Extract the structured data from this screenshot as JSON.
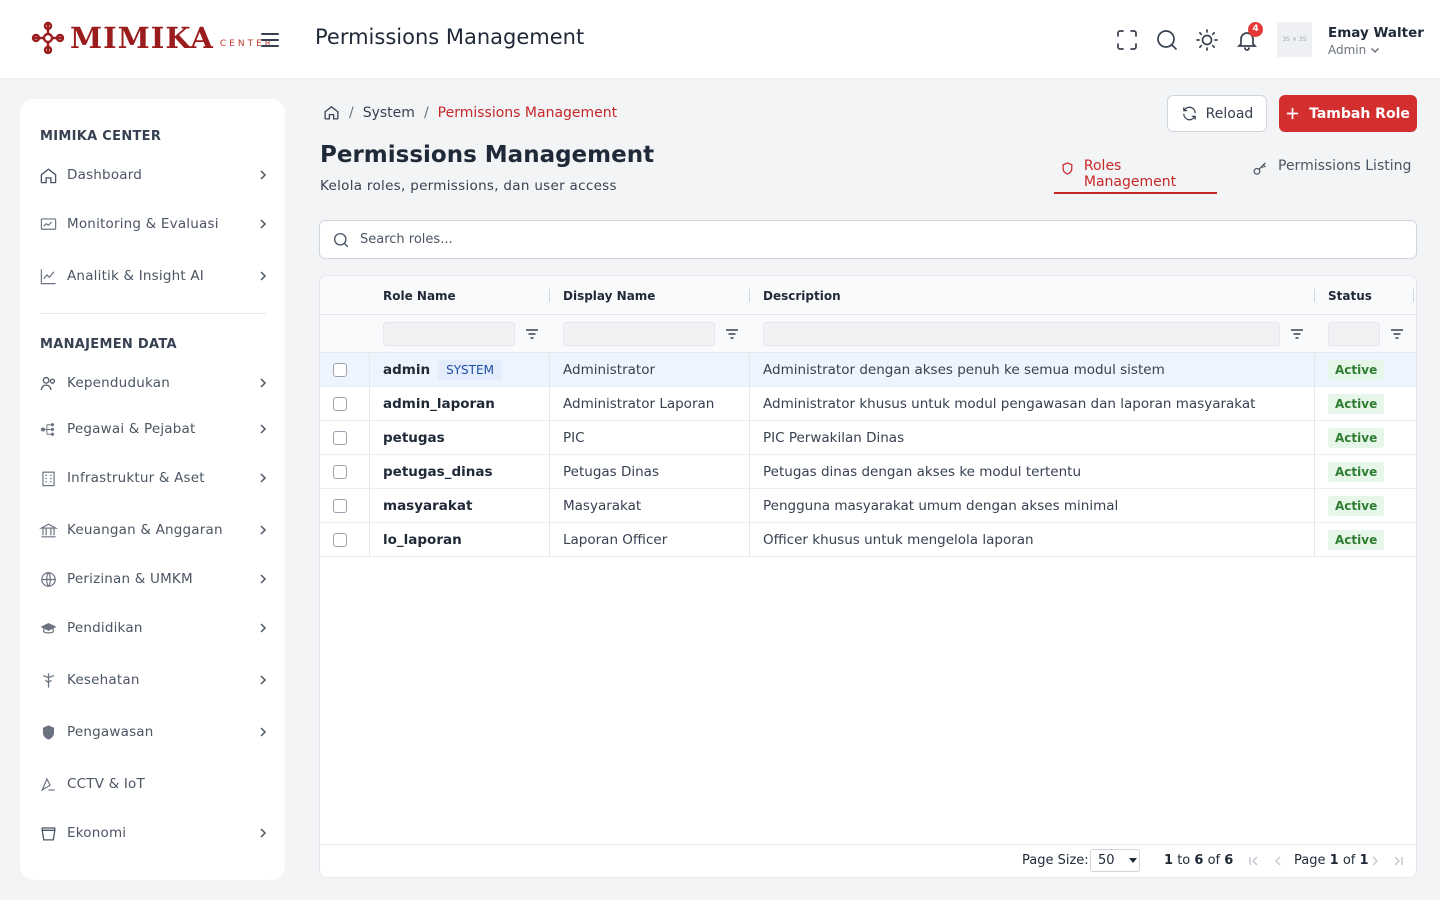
{
  "brand": {
    "name": "MIMIKA",
    "sub": "CENTER"
  },
  "header": {
    "title": "Permissions Management",
    "notification_count": "4",
    "avatar_placeholder": "35 × 35",
    "user_name": "Emay Walter",
    "user_role": "Admin"
  },
  "sidebar": {
    "section1": "MIMIKA CENTER",
    "section2": "MANAJEMEN DATA",
    "items1": [
      {
        "label": "Dashboard",
        "icon": "home-icon"
      },
      {
        "label": "Monitoring & Evaluasi",
        "icon": "monitor-icon"
      },
      {
        "label": "Analitik & Insight AI",
        "icon": "chart-line-icon"
      }
    ],
    "items2": [
      {
        "label": "Kependudukan",
        "icon": "users-icon"
      },
      {
        "label": "Pegawai & Pejabat",
        "icon": "org-chart-icon"
      },
      {
        "label": "Infrastruktur & Aset",
        "icon": "building-icon"
      },
      {
        "label": "Keuangan & Anggaran",
        "icon": "bank-icon"
      },
      {
        "label": "Perizinan & UMKM",
        "icon": "globe-icon"
      },
      {
        "label": "Pendidikan",
        "icon": "graduation-cap-icon"
      },
      {
        "label": "Kesehatan",
        "icon": "caduceus-icon"
      },
      {
        "label": "Pengawasan",
        "icon": "shield-icon"
      },
      {
        "label": "CCTV & IoT",
        "icon": "cctv-icon"
      },
      {
        "label": "Ekonomi",
        "icon": "basket-icon"
      }
    ]
  },
  "breadcrumb": {
    "level1": "System",
    "sep": "/",
    "current": "Permissions Management"
  },
  "actions": {
    "reload": "Reload",
    "add": "Tambah Role"
  },
  "page": {
    "title": "Permissions Management",
    "subtitle": "Kelola roles, permissions, dan user access"
  },
  "tabs": {
    "roles": "Roles Management",
    "permissions": "Permissions Listing"
  },
  "search": {
    "placeholder": "Search roles..."
  },
  "table": {
    "columns": {
      "role_name": "Role Name",
      "display_name": "Display Name",
      "description": "Description",
      "status": "Status"
    },
    "rows": [
      {
        "role": "admin",
        "badge": "SYSTEM",
        "display": "Administrator",
        "desc": "Administrator dengan akses penuh ke semua modul sistem",
        "status": "Active"
      },
      {
        "role": "admin_laporan",
        "badge": "",
        "display": "Administrator Laporan",
        "desc": "Administrator khusus untuk modul pengawasan dan laporan masyarakat",
        "status": "Active"
      },
      {
        "role": "petugas",
        "badge": "",
        "display": "PIC",
        "desc": "PIC Perwakilan Dinas",
        "status": "Active"
      },
      {
        "role": "petugas_dinas",
        "badge": "",
        "display": "Petugas Dinas",
        "desc": "Petugas dinas dengan akses ke modul tertentu",
        "status": "Active"
      },
      {
        "role": "masyarakat",
        "badge": "",
        "display": "Masyarakat",
        "desc": "Pengguna masyarakat umum dengan akses minimal",
        "status": "Active"
      },
      {
        "role": "lo_laporan",
        "badge": "",
        "display": "Laporan Officer",
        "desc": "Officer khusus untuk mengelola laporan",
        "status": "Active"
      }
    ]
  },
  "pagination": {
    "page_size_label": "Page Size:",
    "page_size": "50",
    "range_from": "1",
    "range_to_word": "to",
    "range_to": "6",
    "range_of_word": "of",
    "range_total": "6",
    "page_word": "Page",
    "page_current": "1",
    "page_of_word": "of",
    "page_total": "1"
  },
  "colors": {
    "brand": "#9b1c1c",
    "accent": "#d32f2f",
    "active_bg": "#e6f6e8",
    "active_text": "#2e7d32",
    "system_bg": "#e3ecfb"
  }
}
